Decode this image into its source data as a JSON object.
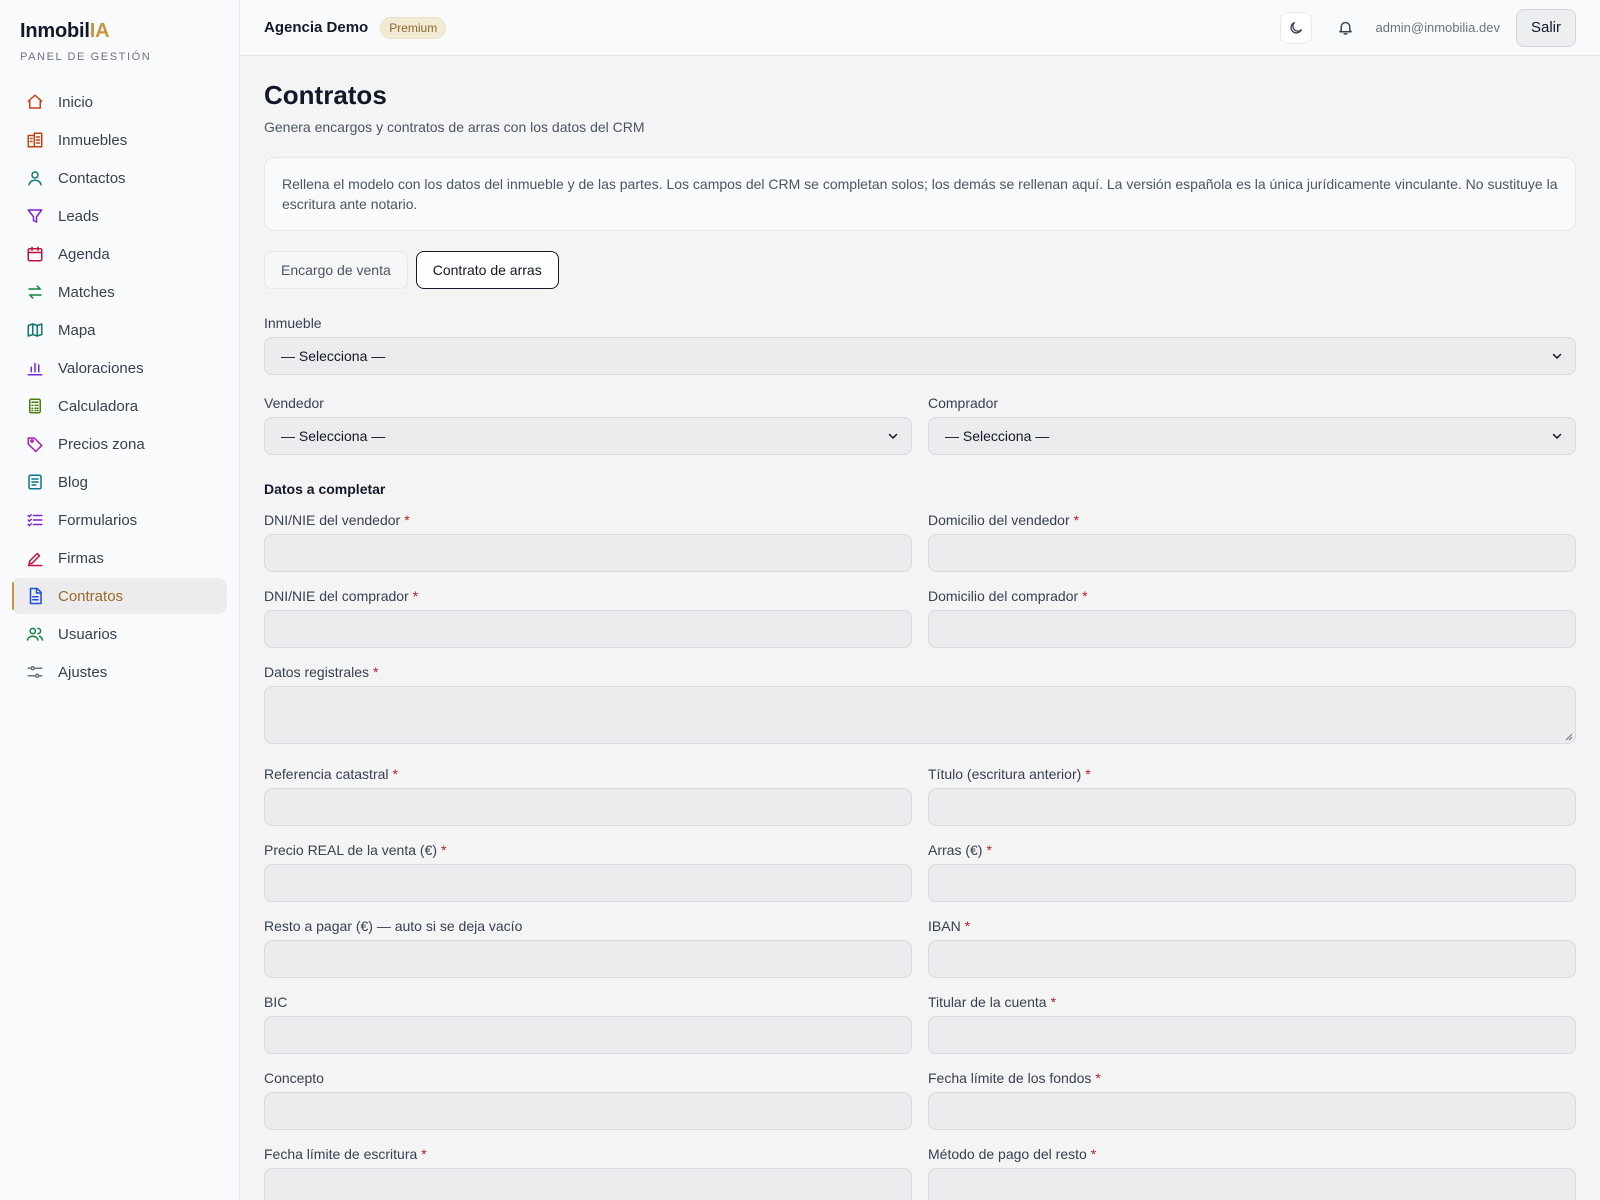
{
  "brand": {
    "name_main": "Inmobil",
    "name_accent": "IA",
    "subtitle": "PANEL DE GESTIÓN"
  },
  "sidebar": {
    "items": [
      {
        "label": "Inicio",
        "icon": "home-icon",
        "color": "#c2410c"
      },
      {
        "label": "Inmuebles",
        "icon": "building-icon",
        "color": "#c2410c"
      },
      {
        "label": "Contactos",
        "icon": "user-icon",
        "color": "#0f766e"
      },
      {
        "label": "Leads",
        "icon": "filter-icon",
        "color": "#7e22ce"
      },
      {
        "label": "Agenda",
        "icon": "calendar-icon",
        "color": "#be123c"
      },
      {
        "label": "Matches",
        "icon": "swap-icon",
        "color": "#15803d"
      },
      {
        "label": "Mapa",
        "icon": "map-icon",
        "color": "#0f766e"
      },
      {
        "label": "Valoraciones",
        "icon": "bar-chart-icon",
        "color": "#6d28d9"
      },
      {
        "label": "Calculadora",
        "icon": "calculator-icon",
        "color": "#4d7c0f"
      },
      {
        "label": "Precios zona",
        "icon": "tag-icon",
        "color": "#a21caf"
      },
      {
        "label": "Blog",
        "icon": "document-lines-icon",
        "color": "#0e7490"
      },
      {
        "label": "Formularios",
        "icon": "checklist-icon",
        "color": "#7e22ce"
      },
      {
        "label": "Firmas",
        "icon": "pen-icon",
        "color": "#be123c"
      },
      {
        "label": "Contratos",
        "icon": "file-text-icon",
        "color": "#1d4ed8",
        "active": true
      },
      {
        "label": "Usuarios",
        "icon": "users-icon",
        "color": "#15803d"
      },
      {
        "label": "Ajustes",
        "icon": "sliders-icon",
        "color": "#6b7280"
      }
    ]
  },
  "header": {
    "agency": "Agencia Demo",
    "plan_badge": "Premium",
    "email": "admin@inmobilia.dev",
    "logout_label": "Salir"
  },
  "page": {
    "title": "Contratos",
    "subtitle": "Genera encargos y contratos de arras con los datos del CRM",
    "notice": "Rellena el modelo con los datos del inmueble y de las partes. Los campos del CRM se completan solos; los demás se rellenan aquí. La versión española es la única jurídicamente vinculante. No sustituye la escritura ante notario."
  },
  "tabs": [
    {
      "label": "Encargo de venta",
      "active": false
    },
    {
      "label": "Contrato de arras",
      "active": true
    }
  ],
  "form": {
    "inmueble": {
      "label": "Inmueble",
      "value": "— Selecciona —"
    },
    "vendedor": {
      "label": "Vendedor",
      "value": "— Selecciona —"
    },
    "comprador": {
      "label": "Comprador",
      "value": "— Selecciona —"
    },
    "section_title": "Datos a completar",
    "required_mark": "*",
    "fields": {
      "dni_vendedor": "DNI/NIE del vendedor",
      "domicilio_vendedor": "Domicilio del vendedor",
      "dni_comprador": "DNI/NIE del comprador",
      "domicilio_comprador": "Domicilio del comprador",
      "datos_registrales": "Datos registrales",
      "referencia_catastral": "Referencia catastral",
      "titulo": "Título (escritura anterior)",
      "precio": "Precio REAL de la venta (€)",
      "arras": "Arras (€)",
      "resto": "Resto a pagar (€) — auto si se deja vacío",
      "iban": "IBAN",
      "bic": "BIC",
      "titular": "Titular de la cuenta",
      "concepto": "Concepto",
      "fecha_fondos": "Fecha límite de los fondos",
      "fecha_escritura": "Fecha límite de escritura",
      "metodo_pago": "Método de pago del resto"
    }
  }
}
